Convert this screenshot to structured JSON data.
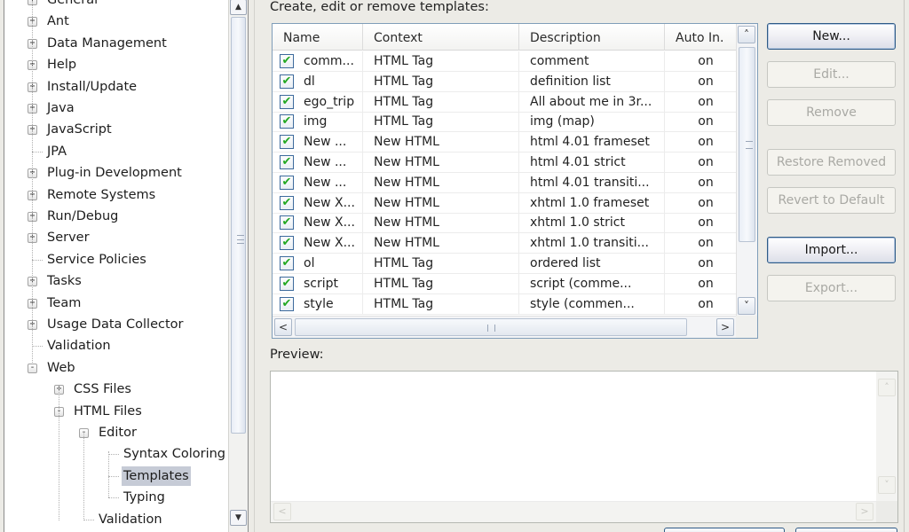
{
  "tree": {
    "items": [
      {
        "label": "General",
        "toggle": "+",
        "level": 0
      },
      {
        "label": "Ant",
        "toggle": "+",
        "level": 0
      },
      {
        "label": "Data Management",
        "toggle": "+",
        "level": 0
      },
      {
        "label": "Help",
        "toggle": "+",
        "level": 0
      },
      {
        "label": "Install/Update",
        "toggle": "+",
        "level": 0
      },
      {
        "label": "Java",
        "toggle": "+",
        "level": 0
      },
      {
        "label": "JavaScript",
        "toggle": "+",
        "level": 0
      },
      {
        "label": "JPA",
        "toggle": "",
        "level": 0
      },
      {
        "label": "Plug-in Development",
        "toggle": "+",
        "level": 0
      },
      {
        "label": "Remote Systems",
        "toggle": "+",
        "level": 0
      },
      {
        "label": "Run/Debug",
        "toggle": "+",
        "level": 0
      },
      {
        "label": "Server",
        "toggle": "+",
        "level": 0
      },
      {
        "label": "Service Policies",
        "toggle": "",
        "level": 0
      },
      {
        "label": "Tasks",
        "toggle": "+",
        "level": 0
      },
      {
        "label": "Team",
        "toggle": "+",
        "level": 0
      },
      {
        "label": "Usage Data Collector",
        "toggle": "+",
        "level": 0
      },
      {
        "label": "Validation",
        "toggle": "",
        "level": 0
      },
      {
        "label": "Web",
        "toggle": "-",
        "level": 0
      },
      {
        "label": "CSS Files",
        "toggle": "+",
        "level": 1
      },
      {
        "label": "HTML Files",
        "toggle": "-",
        "level": 1
      },
      {
        "label": "Editor",
        "toggle": "-",
        "level": 2
      },
      {
        "label": "Syntax Coloring",
        "toggle": "",
        "level": 3
      },
      {
        "label": "Templates",
        "toggle": "",
        "level": 3,
        "selected": true
      },
      {
        "label": "Typing",
        "toggle": "",
        "level": 3
      },
      {
        "label": "Validation",
        "toggle": "",
        "level": 2
      }
    ],
    "scroll_up_glyph": "▲",
    "scroll_down_glyph": "▼"
  },
  "templates": {
    "heading": "Create, edit or remove templates:",
    "columns": [
      "Name",
      "Context",
      "Description",
      "Auto In."
    ],
    "check_glyph": "✔",
    "rows": [
      {
        "enabled": true,
        "name": "comm...",
        "context": "HTML Tag",
        "description": "comment",
        "auto": "on"
      },
      {
        "enabled": true,
        "name": "dl",
        "context": "HTML Tag",
        "description": "definition list",
        "auto": "on"
      },
      {
        "enabled": true,
        "name": "ego_trip",
        "context": "HTML Tag",
        "description": "All about me in 3r...",
        "auto": "on"
      },
      {
        "enabled": true,
        "name": "img",
        "context": "HTML Tag",
        "description": "img     (map)",
        "auto": "on"
      },
      {
        "enabled": true,
        "name": "New ...",
        "context": "New HTML",
        "description": "html 4.01 frameset",
        "auto": "on"
      },
      {
        "enabled": true,
        "name": "New ...",
        "context": "New HTML",
        "description": "html 4.01 strict",
        "auto": "on"
      },
      {
        "enabled": true,
        "name": "New ...",
        "context": "New HTML",
        "description": "html 4.01 transiti...",
        "auto": "on"
      },
      {
        "enabled": true,
        "name": "New X...",
        "context": "New HTML",
        "description": "xhtml 1.0 frameset",
        "auto": "on"
      },
      {
        "enabled": true,
        "name": "New X...",
        "context": "New HTML",
        "description": "xhtml 1.0 strict",
        "auto": "on"
      },
      {
        "enabled": true,
        "name": "New X...",
        "context": "New HTML",
        "description": "xhtml 1.0 transiti...",
        "auto": "on"
      },
      {
        "enabled": true,
        "name": "ol",
        "context": "HTML Tag",
        "description": "ordered list",
        "auto": "on"
      },
      {
        "enabled": true,
        "name": "script",
        "context": "HTML Tag",
        "description": "script     (comme...",
        "auto": "on"
      },
      {
        "enabled": true,
        "name": "style",
        "context": "HTML Tag",
        "description": "style     (commen...",
        "auto": "on"
      }
    ],
    "scroll": {
      "up": "˄",
      "down": "˅",
      "left": "<",
      "right": ">"
    }
  },
  "buttons": [
    {
      "id": "new",
      "label": "New...",
      "enabled": true
    },
    {
      "id": "edit",
      "label": "Edit...",
      "enabled": false
    },
    {
      "id": "remove",
      "label": "Remove",
      "enabled": false
    },
    {
      "id": "restore-removed",
      "label": "Restore Removed",
      "enabled": false
    },
    {
      "id": "revert-to-default",
      "label": "Revert to Default",
      "enabled": false
    },
    {
      "id": "import",
      "label": "Import...",
      "enabled": true
    },
    {
      "id": "export",
      "label": "Export...",
      "enabled": false
    }
  ],
  "preview": {
    "label": "Preview:",
    "content": "",
    "scroll": {
      "up": "˄",
      "down": "˅",
      "left": "<",
      "right": ">"
    }
  }
}
